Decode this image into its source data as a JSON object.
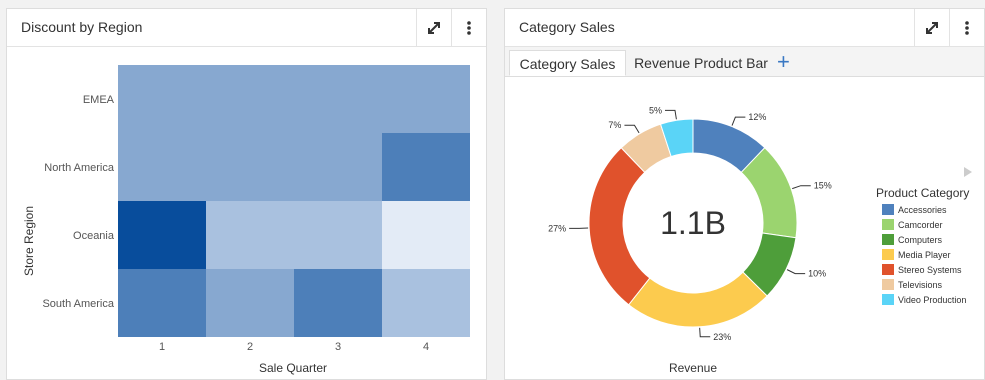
{
  "left_panel": {
    "title": "Discount by Region"
  },
  "right_panel": {
    "title": "Category Sales",
    "tabs": [
      {
        "label": "Category Sales"
      },
      {
        "label": "Revenue Product Bar"
      }
    ],
    "add_tab_label": "+"
  },
  "icons": {
    "expand": "expand-icon",
    "menu": "more-vertical-icon",
    "legend_scroll": "play-right-icon"
  },
  "chart_data": [
    {
      "type": "heatmap",
      "title": "",
      "xlabel": "Sale Quarter",
      "ylabel": "Store Region",
      "x_categories": [
        "1",
        "2",
        "3",
        "4"
      ],
      "y_categories": [
        "EMEA",
        "North America",
        "Oceania",
        "South America"
      ],
      "values": [
        [
          0.45,
          0.45,
          0.45,
          0.45
        ],
        [
          0.45,
          0.45,
          0.45,
          0.7
        ],
        [
          1.0,
          0.3,
          0.3,
          0.05
        ],
        [
          0.7,
          0.45,
          0.7,
          0.3
        ]
      ],
      "color_low": "#eef3fb",
      "color_high": "#084d9c",
      "grid": false
    },
    {
      "type": "pie",
      "style": "donut",
      "center_label": "1.1B",
      "xlabel": "Revenue",
      "legend_title": "Product Category",
      "legend_position": "right",
      "slices": [
        {
          "label": "Accessories",
          "value": 12,
          "value_label": "12%",
          "color": "#4f81bd"
        },
        {
          "label": "Camcorder",
          "value": 15,
          "value_label": "15%",
          "color": "#9bd46f"
        },
        {
          "label": "Computers",
          "value": 10,
          "value_label": "10%",
          "color": "#4e9e3a"
        },
        {
          "label": "Media Player",
          "value": 23,
          "value_label": "23%",
          "color": "#fccb4e"
        },
        {
          "label": "Stereo Systems",
          "value": 27,
          "value_label": "27%",
          "color": "#e0522c"
        },
        {
          "label": "Televisions",
          "value": 7,
          "value_label": "7%",
          "color": "#efcaa0"
        },
        {
          "label": "Video Production",
          "value": 5,
          "value_label": "5%",
          "color": "#5ad4f7"
        }
      ]
    }
  ]
}
